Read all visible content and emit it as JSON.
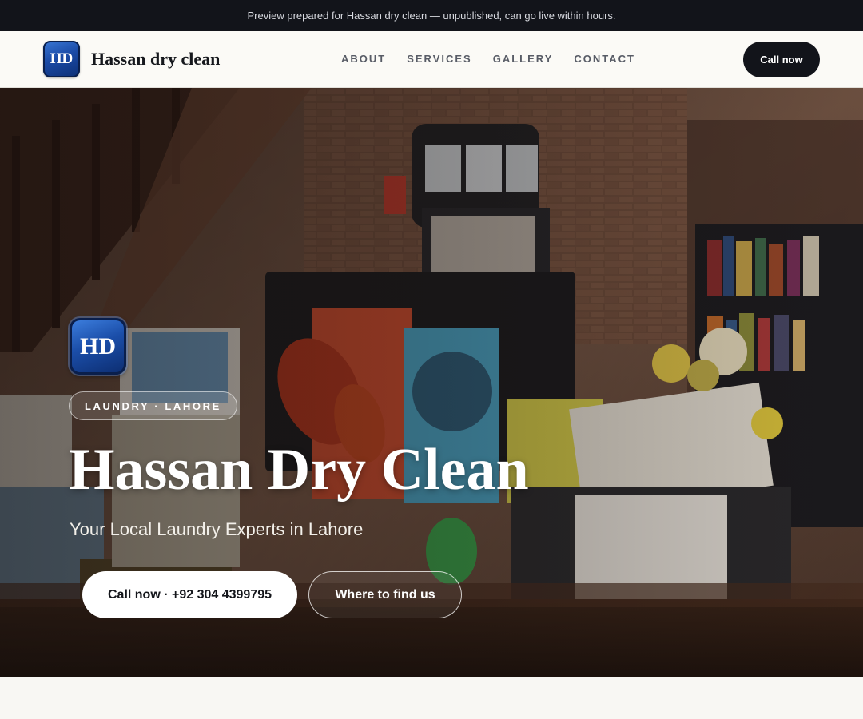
{
  "preview_banner": "Preview prepared for Hassan dry clean — unpublished, can go live within hours.",
  "header": {
    "logo_text": "HD",
    "brand_name": "Hassan dry clean",
    "nav": [
      "ABOUT",
      "SERVICES",
      "GALLERY",
      "CONTACT"
    ],
    "cta": "Call now"
  },
  "hero": {
    "logo_text": "HD",
    "tag": "LAUNDRY · LAHORE",
    "title": "Hassan Dry Clean",
    "subtitle": "Your Local Laundry Experts in Lahore",
    "primary_button": "Call now · +92 304 4399795",
    "secondary_button": "Where to find us",
    "background_image": "shop-interior-photo"
  },
  "colors": {
    "dark": "#12141a",
    "page_bg": "#f8f7f3",
    "logo_blue": "#1a4aa6"
  }
}
